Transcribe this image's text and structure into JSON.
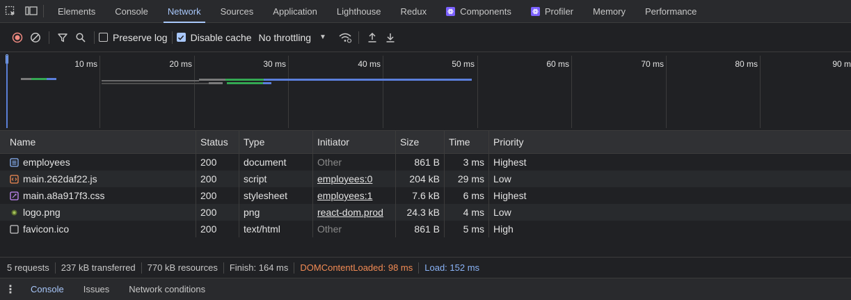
{
  "tabs": [
    {
      "label": "Elements"
    },
    {
      "label": "Console"
    },
    {
      "label": "Network"
    },
    {
      "label": "Sources"
    },
    {
      "label": "Application"
    },
    {
      "label": "Lighthouse"
    },
    {
      "label": "Redux"
    },
    {
      "label": "Components"
    },
    {
      "label": "Profiler"
    },
    {
      "label": "Memory"
    },
    {
      "label": "Performance"
    }
  ],
  "active_tab": "Network",
  "toolbar": {
    "preserve_log_label": "Preserve log",
    "preserve_log_checked": false,
    "disable_cache_label": "Disable cache",
    "disable_cache_checked": true,
    "throttling_value": "No throttling"
  },
  "timeline": {
    "tick_labels": [
      "10 ms",
      "20 ms",
      "30 ms",
      "40 ms",
      "50 ms",
      "60 ms",
      "70 ms",
      "80 ms",
      "90 m"
    ]
  },
  "table": {
    "headers": {
      "name": "Name",
      "status": "Status",
      "type": "Type",
      "initiator": "Initiator",
      "size": "Size",
      "time": "Time",
      "priority": "Priority"
    },
    "rows": [
      {
        "icon": "document-icon",
        "name": "employees",
        "status": "200",
        "type": "document",
        "initiator": "Other",
        "size": "861 B",
        "time": "3 ms",
        "priority": "Highest"
      },
      {
        "icon": "script-icon",
        "name": "main.262daf22.js",
        "status": "200",
        "type": "script",
        "initiator": "employees:0",
        "size": "204 kB",
        "time": "29 ms",
        "priority": "Low"
      },
      {
        "icon": "stylesheet-icon",
        "name": "main.a8a917f3.css",
        "status": "200",
        "type": "stylesheet",
        "initiator": "employees:1",
        "size": "7.6 kB",
        "time": "6 ms",
        "priority": "Highest"
      },
      {
        "icon": "image-icon",
        "name": "logo.png",
        "status": "200",
        "type": "png",
        "initiator": "react-dom.prod",
        "size": "24.3 kB",
        "time": "4 ms",
        "priority": "Low"
      },
      {
        "icon": "file-icon",
        "name": "favicon.ico",
        "status": "200",
        "type": "text/html",
        "initiator": "Other",
        "size": "861 B",
        "time": "5 ms",
        "priority": "High"
      }
    ]
  },
  "status": {
    "requests": "5 requests",
    "transferred": "237 kB transferred",
    "resources": "770 kB resources",
    "finish": "Finish: 164 ms",
    "dom_content_loaded": "DOMContentLoaded: 98 ms",
    "load": "Load: 152 ms"
  },
  "drawer": {
    "tabs": [
      {
        "label": "Console"
      },
      {
        "label": "Issues"
      },
      {
        "label": "Network conditions"
      }
    ]
  },
  "colors": {
    "accent": "#a8c7fa",
    "dom_content_loaded": "#f28b54",
    "load": "#8ab4f8",
    "react_badge": "#7b61ff"
  }
}
